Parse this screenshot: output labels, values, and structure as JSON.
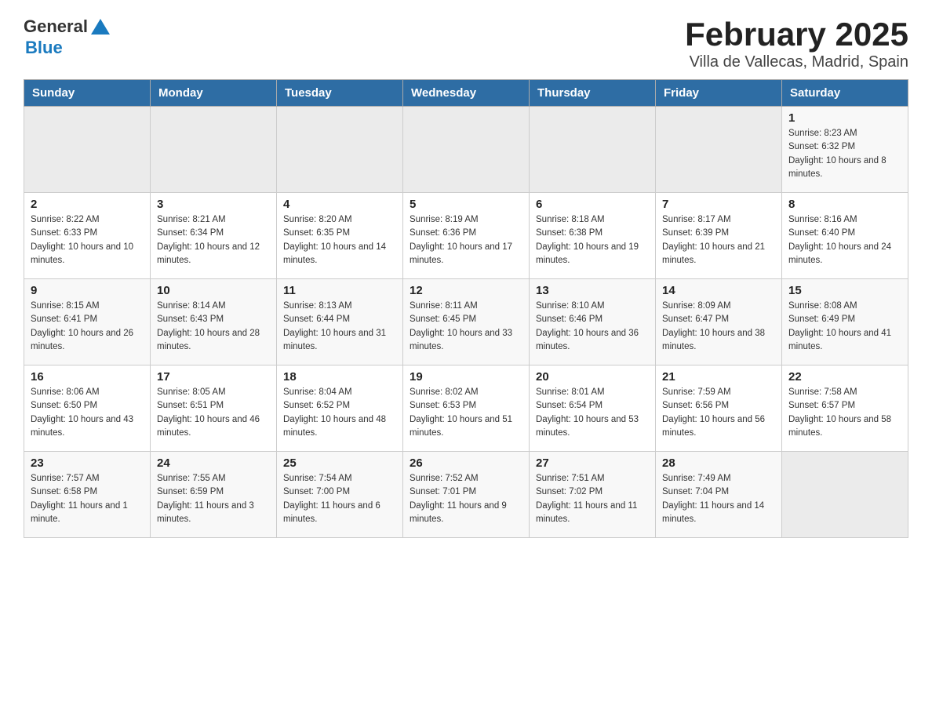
{
  "header": {
    "logo_general": "General",
    "logo_blue": "Blue",
    "title": "February 2025",
    "subtitle": "Villa de Vallecas, Madrid, Spain"
  },
  "calendar": {
    "days_of_week": [
      "Sunday",
      "Monday",
      "Tuesday",
      "Wednesday",
      "Thursday",
      "Friday",
      "Saturday"
    ],
    "weeks": [
      {
        "days": [
          {
            "num": "",
            "info": ""
          },
          {
            "num": "",
            "info": ""
          },
          {
            "num": "",
            "info": ""
          },
          {
            "num": "",
            "info": ""
          },
          {
            "num": "",
            "info": ""
          },
          {
            "num": "",
            "info": ""
          },
          {
            "num": "1",
            "info": "Sunrise: 8:23 AM\nSunset: 6:32 PM\nDaylight: 10 hours and 8 minutes."
          }
        ]
      },
      {
        "days": [
          {
            "num": "2",
            "info": "Sunrise: 8:22 AM\nSunset: 6:33 PM\nDaylight: 10 hours and 10 minutes."
          },
          {
            "num": "3",
            "info": "Sunrise: 8:21 AM\nSunset: 6:34 PM\nDaylight: 10 hours and 12 minutes."
          },
          {
            "num": "4",
            "info": "Sunrise: 8:20 AM\nSunset: 6:35 PM\nDaylight: 10 hours and 14 minutes."
          },
          {
            "num": "5",
            "info": "Sunrise: 8:19 AM\nSunset: 6:36 PM\nDaylight: 10 hours and 17 minutes."
          },
          {
            "num": "6",
            "info": "Sunrise: 8:18 AM\nSunset: 6:38 PM\nDaylight: 10 hours and 19 minutes."
          },
          {
            "num": "7",
            "info": "Sunrise: 8:17 AM\nSunset: 6:39 PM\nDaylight: 10 hours and 21 minutes."
          },
          {
            "num": "8",
            "info": "Sunrise: 8:16 AM\nSunset: 6:40 PM\nDaylight: 10 hours and 24 minutes."
          }
        ]
      },
      {
        "days": [
          {
            "num": "9",
            "info": "Sunrise: 8:15 AM\nSunset: 6:41 PM\nDaylight: 10 hours and 26 minutes."
          },
          {
            "num": "10",
            "info": "Sunrise: 8:14 AM\nSunset: 6:43 PM\nDaylight: 10 hours and 28 minutes."
          },
          {
            "num": "11",
            "info": "Sunrise: 8:13 AM\nSunset: 6:44 PM\nDaylight: 10 hours and 31 minutes."
          },
          {
            "num": "12",
            "info": "Sunrise: 8:11 AM\nSunset: 6:45 PM\nDaylight: 10 hours and 33 minutes."
          },
          {
            "num": "13",
            "info": "Sunrise: 8:10 AM\nSunset: 6:46 PM\nDaylight: 10 hours and 36 minutes."
          },
          {
            "num": "14",
            "info": "Sunrise: 8:09 AM\nSunset: 6:47 PM\nDaylight: 10 hours and 38 minutes."
          },
          {
            "num": "15",
            "info": "Sunrise: 8:08 AM\nSunset: 6:49 PM\nDaylight: 10 hours and 41 minutes."
          }
        ]
      },
      {
        "days": [
          {
            "num": "16",
            "info": "Sunrise: 8:06 AM\nSunset: 6:50 PM\nDaylight: 10 hours and 43 minutes."
          },
          {
            "num": "17",
            "info": "Sunrise: 8:05 AM\nSunset: 6:51 PM\nDaylight: 10 hours and 46 minutes."
          },
          {
            "num": "18",
            "info": "Sunrise: 8:04 AM\nSunset: 6:52 PM\nDaylight: 10 hours and 48 minutes."
          },
          {
            "num": "19",
            "info": "Sunrise: 8:02 AM\nSunset: 6:53 PM\nDaylight: 10 hours and 51 minutes."
          },
          {
            "num": "20",
            "info": "Sunrise: 8:01 AM\nSunset: 6:54 PM\nDaylight: 10 hours and 53 minutes."
          },
          {
            "num": "21",
            "info": "Sunrise: 7:59 AM\nSunset: 6:56 PM\nDaylight: 10 hours and 56 minutes."
          },
          {
            "num": "22",
            "info": "Sunrise: 7:58 AM\nSunset: 6:57 PM\nDaylight: 10 hours and 58 minutes."
          }
        ]
      },
      {
        "days": [
          {
            "num": "23",
            "info": "Sunrise: 7:57 AM\nSunset: 6:58 PM\nDaylight: 11 hours and 1 minute."
          },
          {
            "num": "24",
            "info": "Sunrise: 7:55 AM\nSunset: 6:59 PM\nDaylight: 11 hours and 3 minutes."
          },
          {
            "num": "25",
            "info": "Sunrise: 7:54 AM\nSunset: 7:00 PM\nDaylight: 11 hours and 6 minutes."
          },
          {
            "num": "26",
            "info": "Sunrise: 7:52 AM\nSunset: 7:01 PM\nDaylight: 11 hours and 9 minutes."
          },
          {
            "num": "27",
            "info": "Sunrise: 7:51 AM\nSunset: 7:02 PM\nDaylight: 11 hours and 11 minutes."
          },
          {
            "num": "28",
            "info": "Sunrise: 7:49 AM\nSunset: 7:04 PM\nDaylight: 11 hours and 14 minutes."
          },
          {
            "num": "",
            "info": ""
          }
        ]
      }
    ]
  }
}
